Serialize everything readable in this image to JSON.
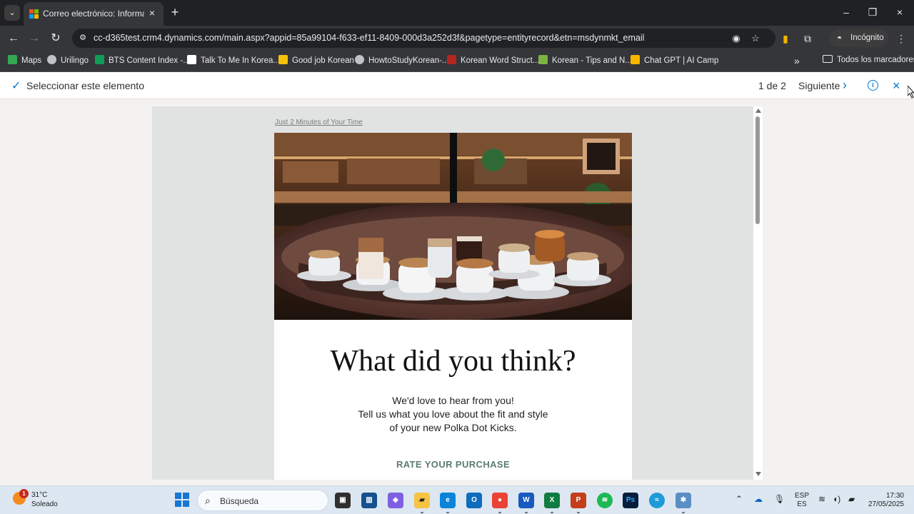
{
  "browser": {
    "tab_title": "Correo electrónico: Información",
    "url": "cc-d365test.crm4.dynamics.com/main.aspx?appid=85a99104-f633-ef11-8409-000d3a252d3f&pagetype=entityrecord&etn=msdynmkt_email",
    "profile_label": "Incógnito",
    "bookmarks": [
      "Maps",
      "Urilingo",
      "BTS Content Index -...",
      "Talk To Me In Korea...",
      "Good job Korean",
      "HowtoStudyKorean-...",
      "Korean Word Struct...",
      "Korean - Tips and N...",
      "Chat GPT | AI Camp"
    ],
    "all_bookmarks_label": "Todos los marcadores"
  },
  "selection_bar": {
    "select_label": "Seleccionar este elemento",
    "counter": "1 de 2",
    "next_label": "Siguiente"
  },
  "email": {
    "top_link": "Just 2 Minutes of Your Time",
    "headline": "What did you think?",
    "body_lines": [
      "We'd love to hear from you!",
      "Tell us what you love about the fit and style",
      "of your new Polka Dot Kicks."
    ],
    "cta": "RATE YOUR PURCHASE"
  },
  "taskbar": {
    "weather_temp": "31°C",
    "weather_condition": "Soleado",
    "weather_notification": "1",
    "search_placeholder": "Búsqueda",
    "language_line1": "ESP",
    "language_line2": "ES",
    "time": "17:30",
    "date": "27/05/2025"
  },
  "colors": {
    "browser_background": "#202124",
    "dynamics_accent": "#0078d4",
    "email_cta": "#5b7d6f",
    "taskbar": "#dce7f1"
  }
}
